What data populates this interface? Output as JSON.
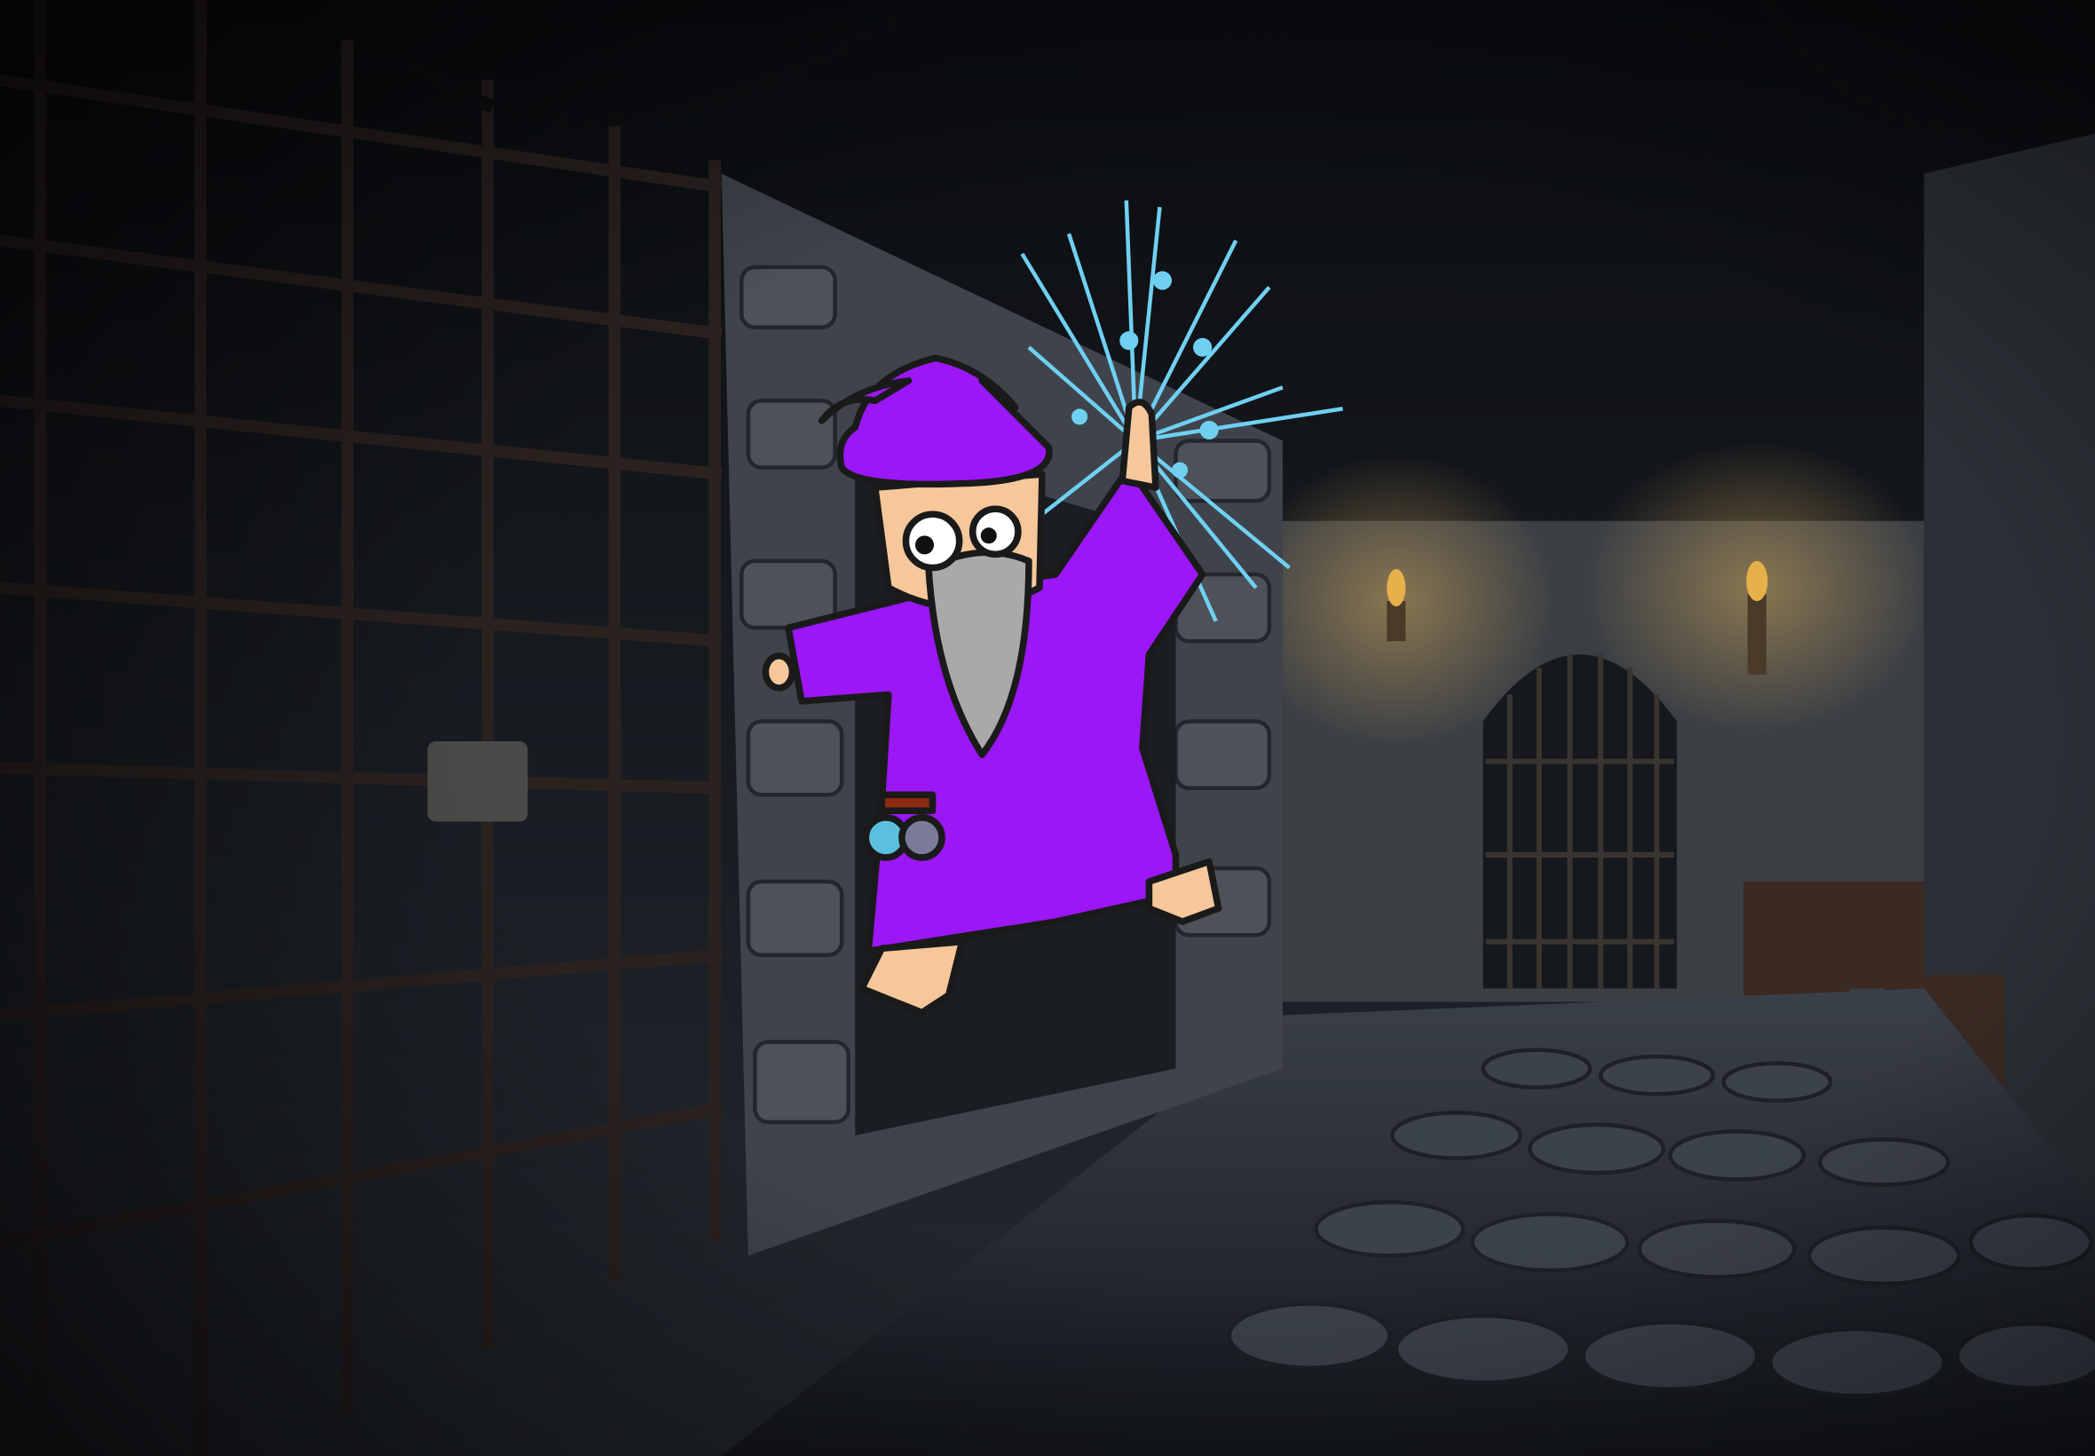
{
  "colors": {
    "background": "#0b0d12",
    "stone": "#3a3f47",
    "floor": "#2a2f38",
    "bars": "#2b2220",
    "torch": "#e8b04a",
    "robe": "#9b17f5",
    "skin": "#f6c79a",
    "beard": "#a9a9a9",
    "magic": "#6fd0f2",
    "outline": "#1a1a1a"
  }
}
